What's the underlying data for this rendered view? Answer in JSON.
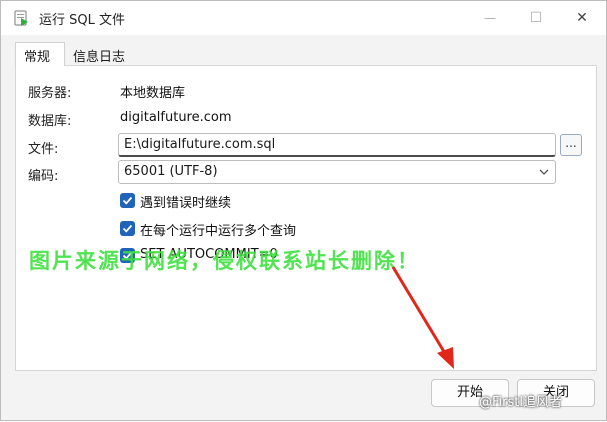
{
  "window": {
    "title": "运行 SQL 文件",
    "minimize_glyph": "—",
    "maximize_glyph": "☐",
    "close_glyph": "✕"
  },
  "tabs": [
    {
      "label": "常规",
      "active": true
    },
    {
      "label": "信息日志",
      "active": false
    }
  ],
  "form": {
    "server_label": "服务器:",
    "server_value": "本地数据库",
    "database_label": "数据库:",
    "database_value": "digitalfuture.com",
    "file_label": "文件:",
    "file_value": "E:\\digitalfuture.com.sql",
    "browse_label": "...",
    "encoding_label": "编码:",
    "encoding_value": "65001 (UTF-8)"
  },
  "options": [
    {
      "label": "遇到错误时继续",
      "checked": true
    },
    {
      "label": "在每个运行中运行多个查询",
      "checked": true
    },
    {
      "label": "SET AUTOCOMMIT=0",
      "checked": true
    }
  ],
  "overlay": {
    "watermark": "图片来源于网络，侵权联系站长删除！",
    "arrow_color": "#e0271a",
    "credit": "@Firstl追风者"
  },
  "footer": {
    "start_label": "开始",
    "close_label": "关闭"
  },
  "colors": {
    "checkbox": "#1f64b8",
    "watermark": "#3fe03f"
  }
}
